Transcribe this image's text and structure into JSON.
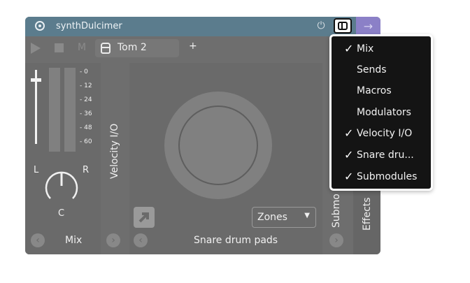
{
  "titlebar": {
    "title": "synthDulcimer",
    "power_icon": "power-icon",
    "arrow_icon": "arrow-right-icon"
  },
  "toolbar": {
    "m_label": "M",
    "instrument_name": "Tom  2",
    "add_label": "+"
  },
  "mix": {
    "ticks": [
      "0",
      "12",
      "24",
      "36",
      "48",
      "60"
    ],
    "left_label": "L",
    "right_label": "R",
    "center_label": "C",
    "label": "Mix"
  },
  "velocity": {
    "label": "Velocity I/O"
  },
  "pads": {
    "zones_value": "Zones",
    "label": "Snare drum pads"
  },
  "submodules": {
    "label": "Submo"
  },
  "effects": {
    "label": "Effects"
  },
  "nav": {
    "left_glyph": "‹",
    "right_glyph": "›"
  },
  "menu": {
    "check_glyph": "✓",
    "items": [
      {
        "label": "Mix",
        "checked": true
      },
      {
        "label": "Sends",
        "checked": false
      },
      {
        "label": "Macros",
        "checked": false
      },
      {
        "label": "Modulators",
        "checked": false
      },
      {
        "label": "Velocity I/O",
        "checked": true
      },
      {
        "label": "Snare dru...",
        "checked": true
      },
      {
        "label": "Submodules",
        "checked": true
      }
    ]
  },
  "colors": {
    "titlebar": "#5b7c8d",
    "accent": "#8b80c7",
    "menu_bg": "#141414"
  }
}
